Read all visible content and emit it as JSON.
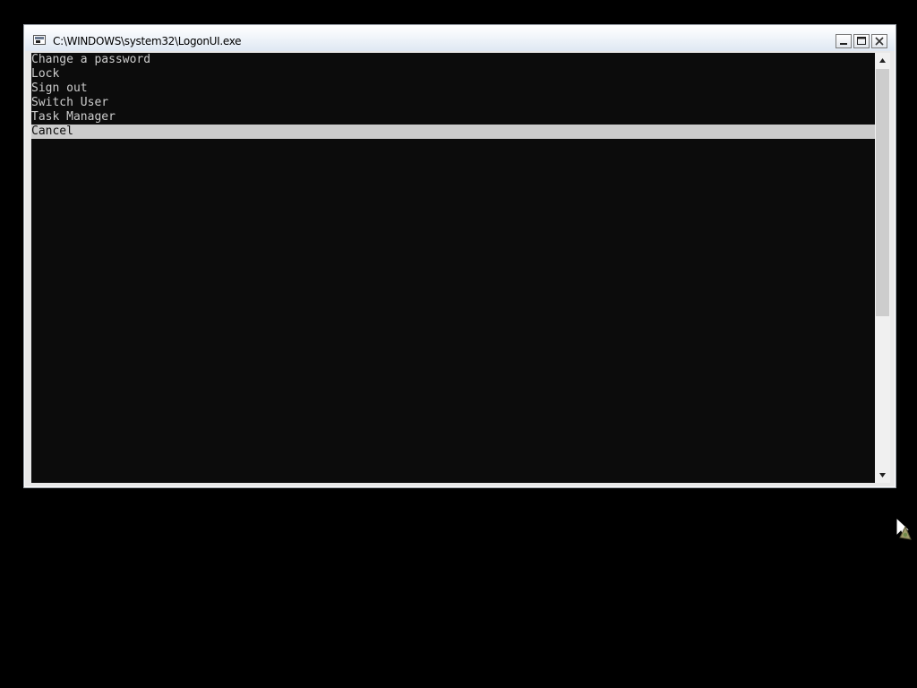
{
  "window": {
    "title": "C:\\WINDOWS\\system32\\LogonUI.exe"
  },
  "menu": {
    "items": [
      {
        "label": "Change a password",
        "selected": false
      },
      {
        "label": "Lock",
        "selected": false
      },
      {
        "label": "Sign out",
        "selected": false
      },
      {
        "label": "Switch User",
        "selected": false
      },
      {
        "label": "Task Manager",
        "selected": false
      },
      {
        "label": "Cancel",
        "selected": true
      }
    ]
  },
  "icons": {
    "app": "console-window-icon",
    "minimize": "minimize-icon",
    "maximize": "maximize-icon",
    "close": "close-icon",
    "scroll_up": "arrow-up-icon",
    "scroll_down": "arrow-down-icon",
    "cursor": "busy-cursor-icon"
  },
  "colors": {
    "console_background": "#0c0c0c",
    "console_text": "#cccccc",
    "selection_background": "#cccccc",
    "selection_text": "#0c0c0c",
    "desktop_background": "#000000"
  }
}
